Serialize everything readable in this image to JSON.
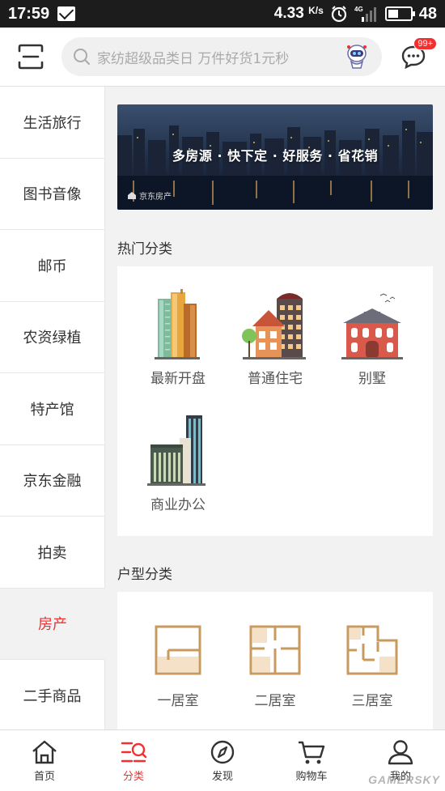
{
  "status_bar": {
    "time": "17:59",
    "net_speed": "4.33",
    "net_unit": "K/s",
    "network": "4G",
    "battery": "48",
    "battery_level": 0.48
  },
  "header": {
    "search_placeholder": "家纺超级品类日 万件好货1元秒",
    "message_badge": "99+"
  },
  "sidebar": {
    "items": [
      {
        "label": "生活旅行"
      },
      {
        "label": "图书音像"
      },
      {
        "label": "邮币"
      },
      {
        "label": "农资绿植"
      },
      {
        "label": "特产馆"
      },
      {
        "label": "京东金融"
      },
      {
        "label": "拍卖"
      },
      {
        "label": "房产"
      },
      {
        "label": "二手商品"
      }
    ],
    "active": "房产"
  },
  "banner": {
    "slogan": "多房源 · 快下定 · 好服务 · 省花销",
    "brand": "京东房产"
  },
  "hot_categories": {
    "title": "热门分类",
    "items": [
      {
        "label": "最新开盘",
        "icon": "tower-buildings-icon"
      },
      {
        "label": "普通住宅",
        "icon": "residential-house-icon"
      },
      {
        "label": "别墅",
        "icon": "villa-icon"
      },
      {
        "label": "商业办公",
        "icon": "office-buildings-icon"
      }
    ]
  },
  "layout_categories": {
    "title": "户型分类",
    "items": [
      {
        "label": "一居室",
        "icon": "floorplan-one-room-icon"
      },
      {
        "label": "二居室",
        "icon": "floorplan-two-room-icon"
      },
      {
        "label": "三居室",
        "icon": "floorplan-three-room-icon"
      }
    ]
  },
  "bottom_nav": {
    "items": [
      {
        "label": "首页",
        "icon": "home-icon"
      },
      {
        "label": "分类",
        "icon": "category-icon"
      },
      {
        "label": "发现",
        "icon": "compass-icon"
      },
      {
        "label": "购物车",
        "icon": "cart-icon"
      },
      {
        "label": "我的",
        "icon": "user-icon"
      }
    ],
    "active": "分类"
  },
  "watermark": "GAMERSKY",
  "colors": {
    "accent": "#f23030",
    "floorplan": "#c89a5e",
    "floorplan_fill": "#f5e1c8"
  }
}
